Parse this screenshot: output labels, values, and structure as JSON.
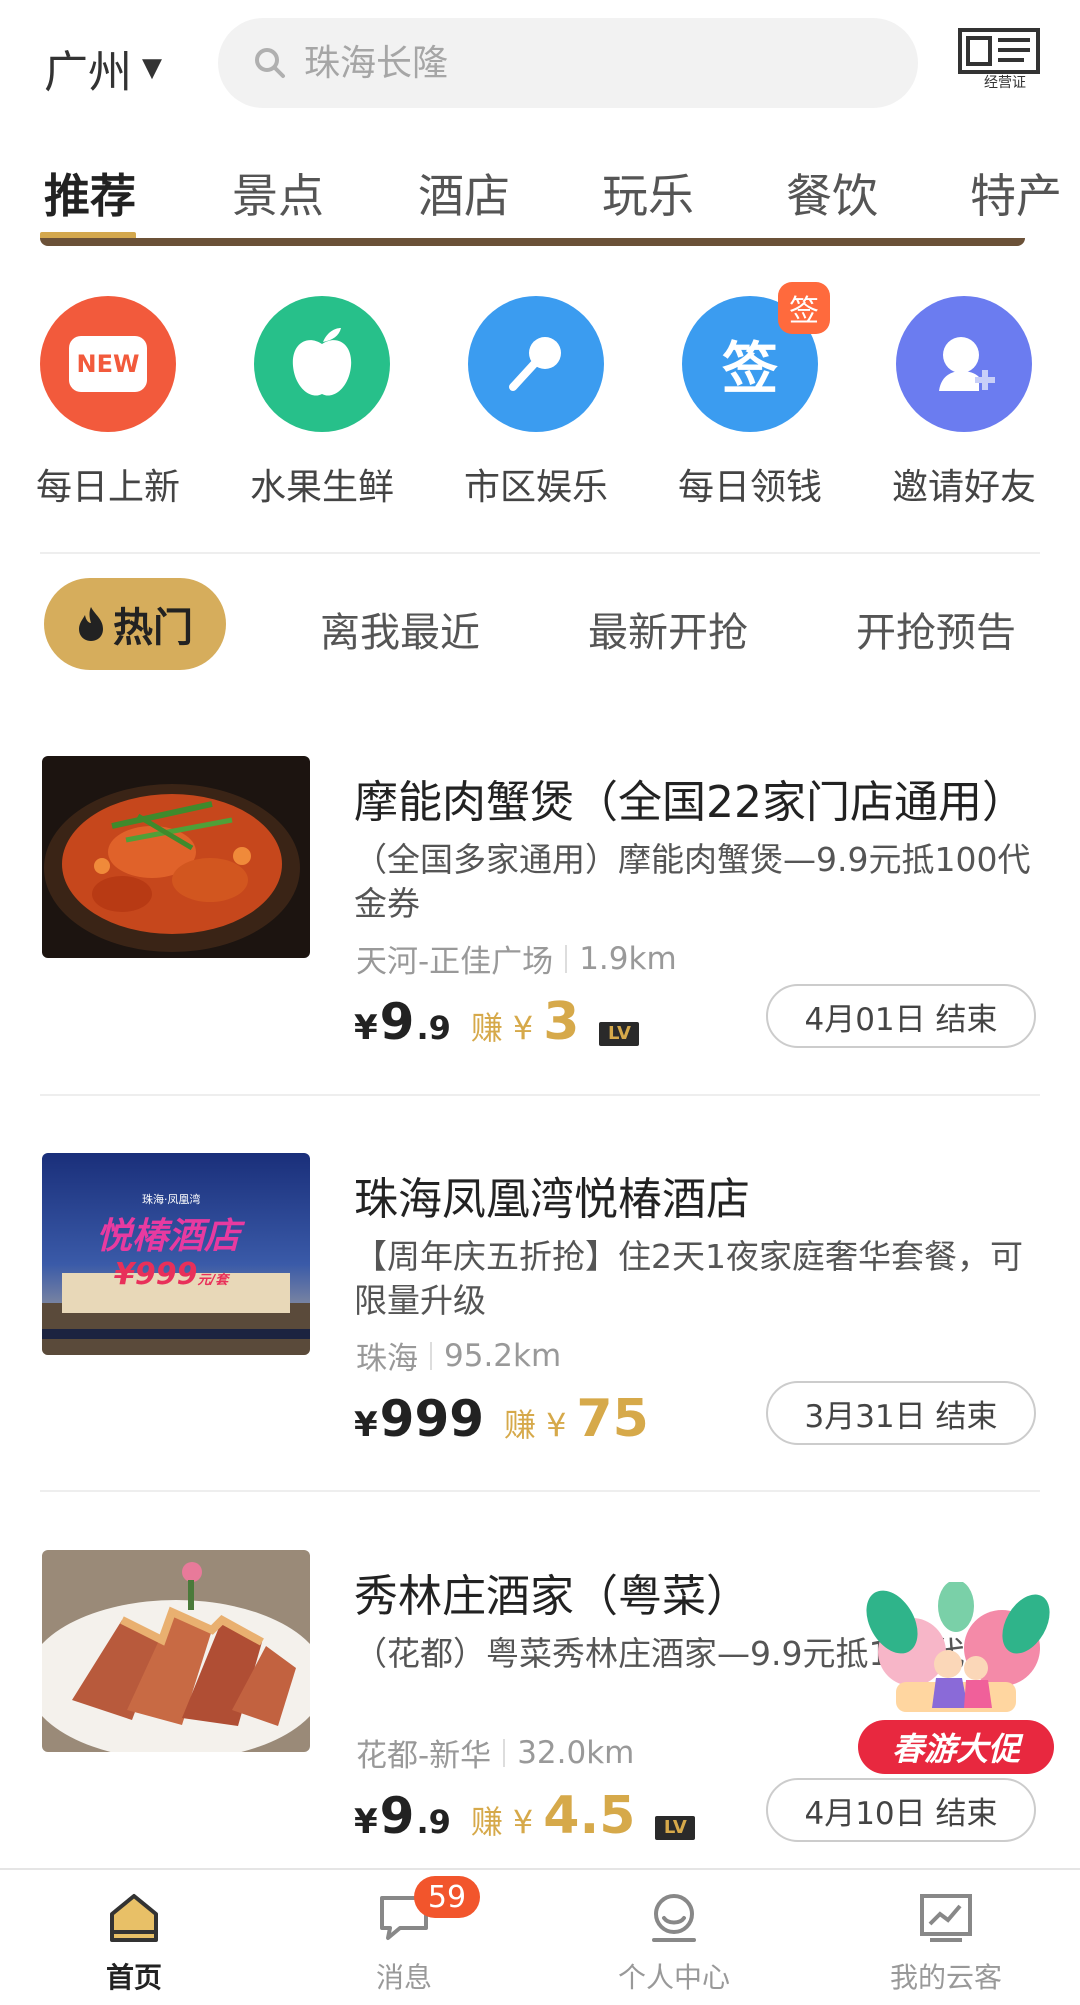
{
  "header": {
    "city": "广州",
    "search_placeholder": "珠海长隆",
    "license_label": "经营证"
  },
  "tabs": [
    {
      "label": "推荐",
      "active": true
    },
    {
      "label": "景点"
    },
    {
      "label": "酒店"
    },
    {
      "label": "玩乐"
    },
    {
      "label": "餐饮"
    },
    {
      "label": "特产"
    }
  ],
  "quick_entries": [
    {
      "label": "每日上新",
      "icon": "new-icon",
      "color": "#f25a3c",
      "icon_text": "NEW"
    },
    {
      "label": "水果生鲜",
      "icon": "apple-icon",
      "color": "#27c08a"
    },
    {
      "label": "市区娱乐",
      "icon": "microphone-icon",
      "color": "#3b9cf0"
    },
    {
      "label": "每日领钱",
      "icon": "sign-icon",
      "color": "#3b9cf0",
      "icon_text": "签",
      "badge": "签"
    },
    {
      "label": "邀请好友",
      "icon": "add-friend-icon",
      "color": "#6b7cf0"
    }
  ],
  "filters": {
    "hot": "热门",
    "items": [
      "离我最近",
      "最新开抢",
      "开抢预告"
    ]
  },
  "deals": [
    {
      "title": "摩能肉蟹煲（全国22家门店通用）",
      "desc": "（全国多家通用）摩能肉蟹煲—9.9元抵100代金券",
      "area": "天河-正佳广场",
      "distance": "1.9km",
      "currency": "¥",
      "price_int": "9",
      "price_dec": ".9",
      "earn_label": "赚",
      "earn_currency": "¥",
      "earn_value": "3",
      "lv": "LV",
      "end": "4月01日  结束"
    },
    {
      "title": "珠海凤凰湾悦椿酒店",
      "desc": "【周年庆五折抢】住2天1夜家庭奢华套餐，可限量升级",
      "area": "珠海",
      "distance": "95.2km",
      "currency": "¥",
      "price_int": "999",
      "price_dec": "",
      "earn_label": "赚",
      "earn_currency": "¥",
      "earn_value": "75",
      "lv": "",
      "end": "3月31日  结束",
      "thumb_text": {
        "small": "珠海·凤凰湾",
        "name": "悦椿酒店",
        "price": "¥999",
        "unit": "元/套"
      }
    },
    {
      "title": "秀林庄酒家（粤菜）",
      "desc": "（花都）粤菜秀林庄酒家—9.9元抵100代金券",
      "area": "花都-新华",
      "distance": "32.0km",
      "currency": "¥",
      "price_int": "9",
      "price_dec": ".9",
      "earn_label": "赚",
      "earn_currency": "¥",
      "earn_value": "4.5",
      "lv": "LV",
      "end": "4月10日  结束"
    }
  ],
  "promo": {
    "label": "春游大促"
  },
  "bottom_nav": [
    {
      "label": "首页",
      "icon": "home-icon",
      "active": true
    },
    {
      "label": "消息",
      "icon": "message-icon",
      "badge": "59"
    },
    {
      "label": "个人中心",
      "icon": "profile-icon"
    },
    {
      "label": "我的云客",
      "icon": "chart-board-icon"
    }
  ],
  "colors": {
    "accent_gold": "#d6ad5c",
    "earn_gold": "#d6a94a",
    "badge_red": "#f2552c"
  }
}
